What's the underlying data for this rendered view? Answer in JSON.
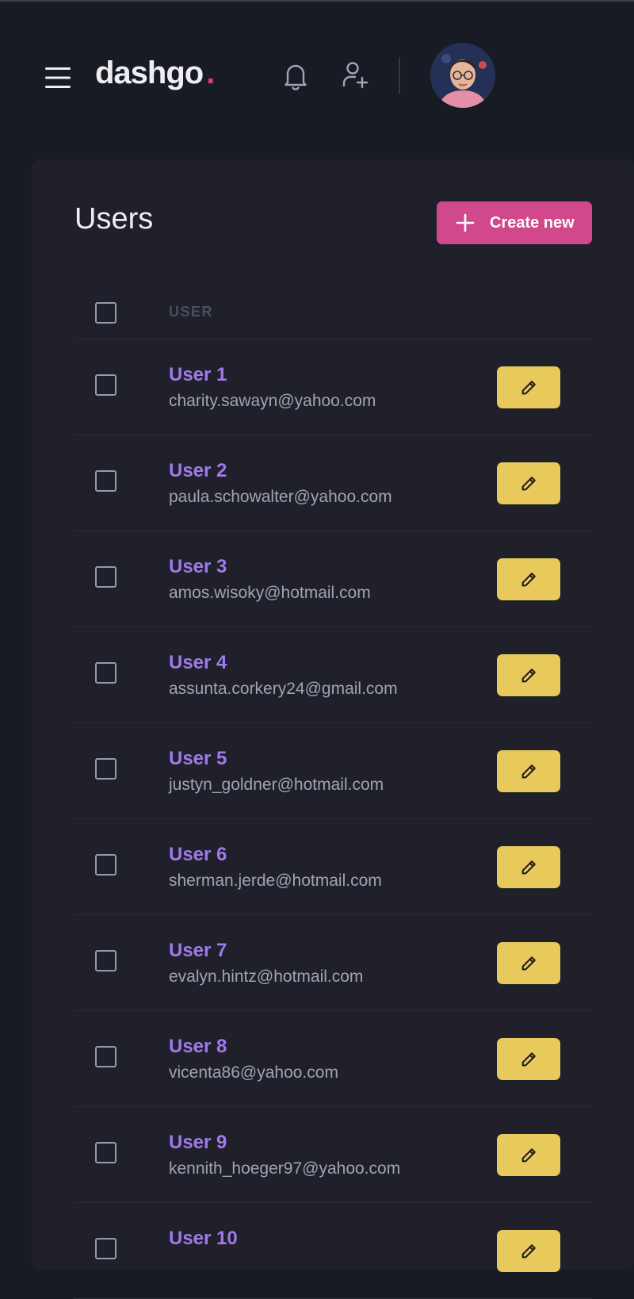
{
  "header": {
    "logo_text": "dashgo",
    "logo_dot": ".",
    "icons": [
      "menu-icon",
      "bell-icon",
      "user-add-icon"
    ],
    "colors": {
      "accent": "#d53f8c",
      "background": "#181b23"
    }
  },
  "main": {
    "title": "Users",
    "create_button_label": "Create new",
    "column_user": "USER",
    "colors": {
      "name": "#9f7aea",
      "edit_button": "#e8c95c",
      "create_button": "#d2488c"
    },
    "users": [
      {
        "name": "User 1",
        "email": "charity.sawayn@yahoo.com"
      },
      {
        "name": "User 2",
        "email": "paula.schowalter@yahoo.com"
      },
      {
        "name": "User 3",
        "email": "amos.wisoky@hotmail.com"
      },
      {
        "name": "User 4",
        "email": "assunta.corkery24@gmail.com"
      },
      {
        "name": "User 5",
        "email": "justyn_goldner@hotmail.com"
      },
      {
        "name": "User 6",
        "email": "sherman.jerde@hotmail.com"
      },
      {
        "name": "User 7",
        "email": "evalyn.hintz@hotmail.com"
      },
      {
        "name": "User 8",
        "email": "vicenta86@yahoo.com"
      },
      {
        "name": "User 9",
        "email": "kennith_hoeger97@yahoo.com"
      },
      {
        "name": "User 10",
        "email": ""
      }
    ]
  }
}
